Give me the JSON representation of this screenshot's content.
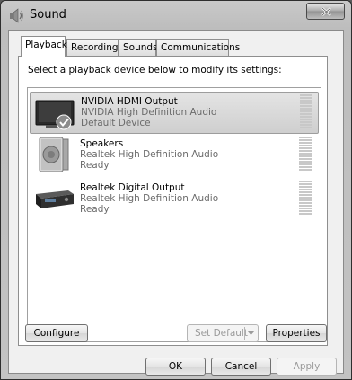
{
  "window": {
    "title": "Sound",
    "icon": "speaker-icon",
    "close_icon": "close-x-icon"
  },
  "tabs": [
    {
      "label": "Playback",
      "active": true
    },
    {
      "label": "Recording",
      "active": false
    },
    {
      "label": "Sounds",
      "active": false
    },
    {
      "label": "Communications",
      "active": false
    }
  ],
  "instruction": "Select a playback device below to modify its settings:",
  "devices": [
    {
      "name": "NVIDIA HDMI Output",
      "driver": "NVIDIA High Definition Audio",
      "status": "Default Device",
      "icon": "monitor-icon",
      "selected": true,
      "default": true
    },
    {
      "name": "Speakers",
      "driver": "Realtek High Definition Audio",
      "status": "Ready",
      "icon": "speakers-icon",
      "selected": false,
      "default": false
    },
    {
      "name": "Realtek Digital Output",
      "driver": "Realtek High Definition Audio",
      "status": "Ready",
      "icon": "digital-receiver-icon",
      "selected": false,
      "default": false
    }
  ],
  "buttons": {
    "configure": "Configure",
    "set_default": "Set Default",
    "properties": "Properties",
    "ok": "OK",
    "cancel": "Cancel",
    "apply": "Apply"
  }
}
